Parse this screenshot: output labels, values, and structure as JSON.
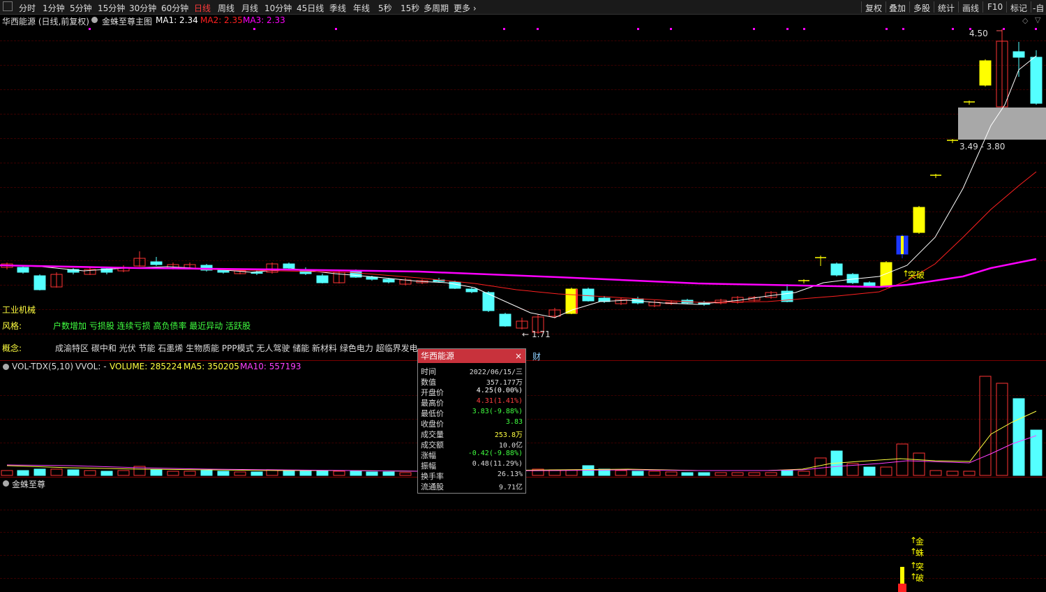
{
  "toolbar": {
    "left_tabs": [
      "分时",
      "1分钟",
      "5分钟",
      "15分钟",
      "30分钟",
      "60分钟",
      "日线",
      "周线",
      "月线",
      "10分钟",
      "45日线",
      "季线",
      "年线",
      "5秒",
      "15秒",
      "多周期",
      "更多 ›"
    ],
    "active_tab": "日线",
    "right_tabs": [
      "复权",
      "叠加",
      "多股",
      "统计",
      "画线",
      "F10",
      "标记",
      "-自"
    ]
  },
  "main_panel": {
    "stock_title": "华西能源 (日线,前复权)",
    "indicator_name": "金蛛至尊主图",
    "ma1": "MA1: 2.34",
    "ma2": "MA2: 2.35",
    "ma3": "MA3: 2.33",
    "price_high_label": "4.50",
    "zone_label": "3.49 - 3.80",
    "low_label": "1.71",
    "breakout_label": "突破",
    "industry": "工业机械",
    "style_label": "风格:",
    "style_tags": "户数增加 亏损股 连续亏损 高负债率 最近异动 活跃股",
    "concept_label": "概念:",
    "concept_tags": "成渝特区 碳中和 光伏 节能 石墨烯 生物质能 PPP模式 无人驾驶 储能 新材料 绿色电力 超临界发电",
    "cai_label": "财",
    "colors": {
      "ma1": "#ffffff",
      "ma2": "#ff2020",
      "ma3": "#ff00ff",
      "up": "#ff3333",
      "down": "#54ffff",
      "signal": "#ffff00"
    }
  },
  "vol_panel": {
    "name": "VOL-TDX(5,10)",
    "vvol": "VVOL: -",
    "volume": "VOLUME: 285224",
    "ma5": "MA5: 350205",
    "ma10": "MA10: 557193"
  },
  "sub_panel": {
    "name": "金蛛至尊",
    "signals": [
      "金",
      "蛛",
      "突",
      "破"
    ]
  },
  "popup": {
    "title": "华西能源",
    "rows": [
      {
        "k": "时间",
        "v": "2022/06/15/三",
        "c": "#dddddd"
      },
      {
        "k": "数值",
        "v": "357.177万",
        "c": "#dddddd"
      },
      {
        "k": "开盘价",
        "v": "4.25(0.00%)",
        "c": "#ffffff"
      },
      {
        "k": "最高价",
        "v": "4.31(1.41%)",
        "c": "#ff4040"
      },
      {
        "k": "最低价",
        "v": "3.83(-9.88%)",
        "c": "#40ff40"
      },
      {
        "k": "收盘价",
        "v": "3.83",
        "c": "#40ff40"
      },
      {
        "k": "成交量",
        "v": "253.8万",
        "c": "#ffff40"
      },
      {
        "k": "成交额",
        "v": "10.0亿",
        "c": "#dddddd"
      },
      {
        "k": "涨幅",
        "v": "-0.42(-9.88%)",
        "c": "#40ff40"
      },
      {
        "k": "振幅",
        "v": "0.48(11.29%)",
        "c": "#dddddd"
      },
      {
        "k": "换手率",
        "v": "26.13%",
        "c": "#dddddd"
      },
      {
        "k": "流通股",
        "v": "9.71亿",
        "c": "#dddddd"
      }
    ]
  }
}
